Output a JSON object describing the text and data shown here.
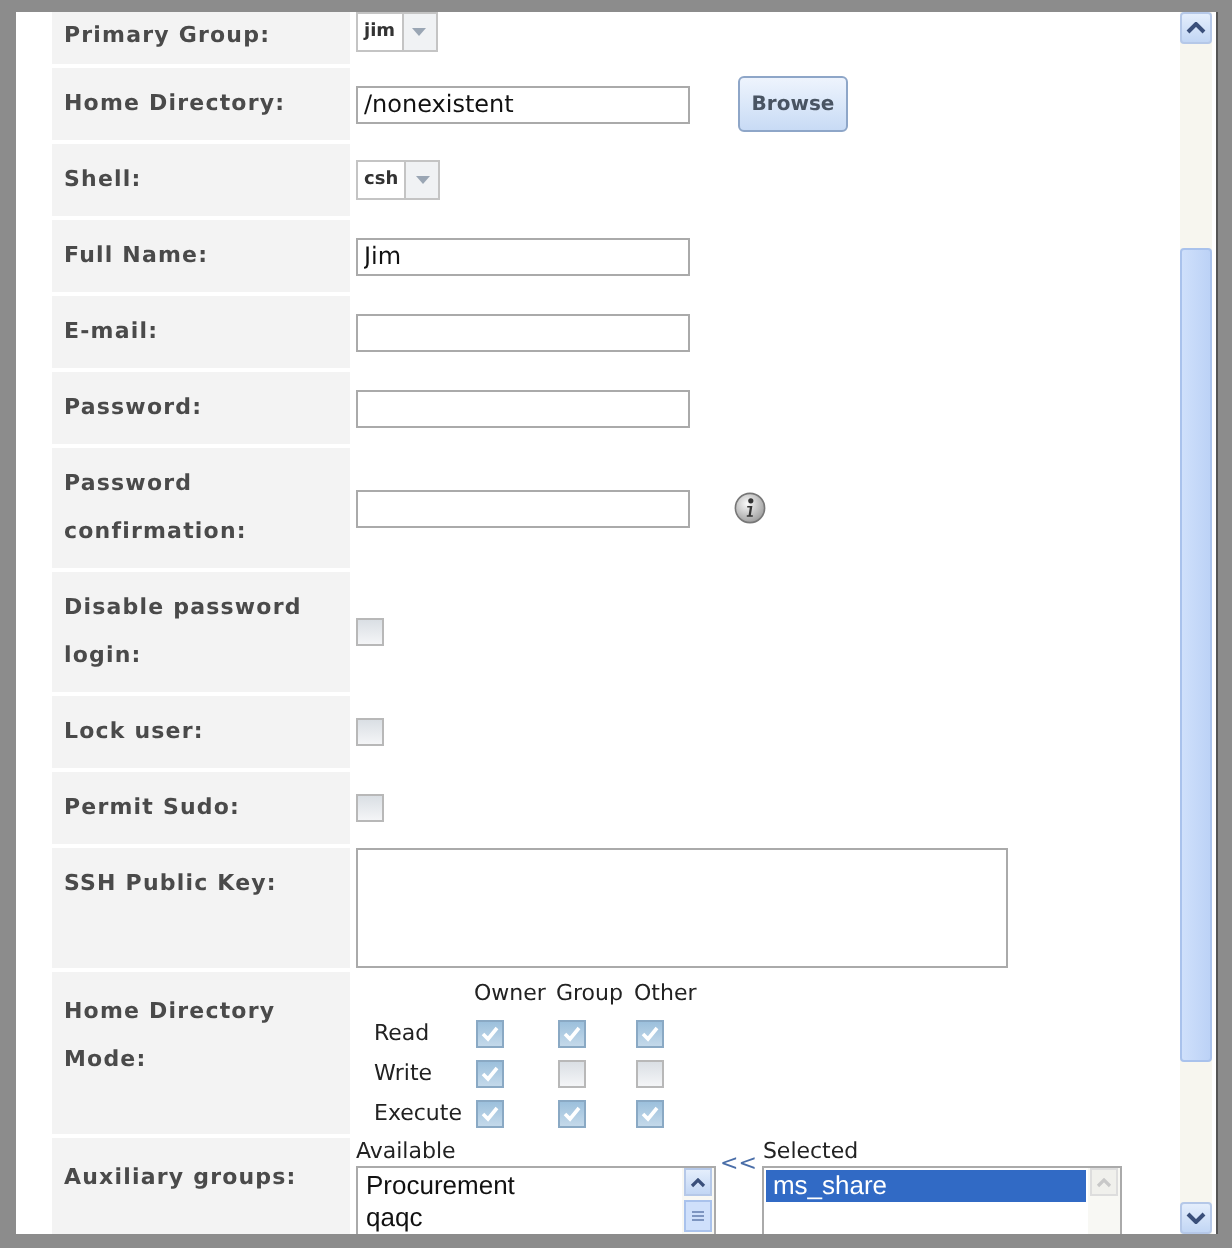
{
  "fields": [
    {
      "kind": "select",
      "label": "Primary Group:",
      "value": "jim"
    },
    {
      "kind": "text",
      "label": "Home Directory:",
      "value": "/nonexistent",
      "button": "Browse"
    },
    {
      "kind": "select",
      "label": "Shell:",
      "value": "csh"
    },
    {
      "kind": "text",
      "label": "Full Name:",
      "value": "Jim"
    },
    {
      "kind": "text",
      "label": "E-mail:"
    },
    {
      "kind": "password",
      "label": "Password:"
    },
    {
      "kind": "password",
      "label": "Password confirmation:",
      "info": true
    },
    {
      "kind": "checkbox",
      "label": "Disable password login:",
      "checked": false
    },
    {
      "kind": "checkbox",
      "label": "Lock user:",
      "checked": false
    },
    {
      "kind": "checkbox",
      "label": "Permit Sudo:",
      "checked": false
    },
    {
      "kind": "textarea",
      "label": "SSH Public Key:"
    },
    {
      "kind": "permissions",
      "label": "Home Directory Mode:",
      "columns": [
        "Owner",
        "Group",
        "Other"
      ],
      "rows": [
        {
          "label": "Read",
          "checked": [
            true,
            true,
            true
          ]
        },
        {
          "label": "Write",
          "checked": [
            true,
            false,
            false
          ]
        },
        {
          "label": "Execute",
          "checked": [
            true,
            true,
            true
          ]
        }
      ]
    },
    {
      "kind": "groups",
      "label": "Auxiliary groups:",
      "available_label": "Available",
      "available": [
        {
          "text": "Procurement",
          "selected": false
        },
        {
          "text": "qaqc",
          "selected": false
        }
      ],
      "move_label": "<<",
      "selected_label": "Selected",
      "selected_items": [
        {
          "text": "ms_share",
          "selected": true
        }
      ]
    }
  ]
}
